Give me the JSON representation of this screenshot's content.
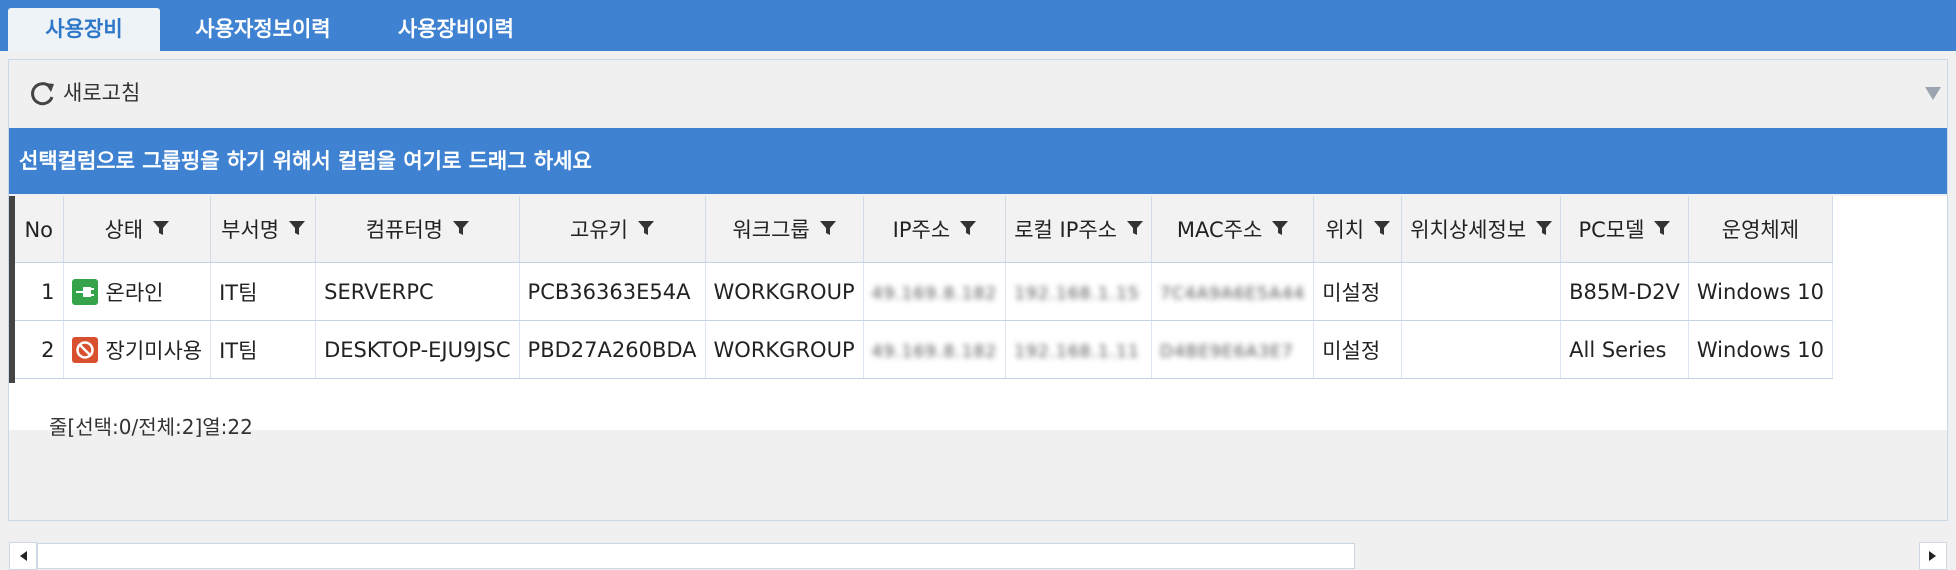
{
  "tabs": [
    {
      "label": "사용장비",
      "active": true
    },
    {
      "label": "사용자정보이력",
      "active": false
    },
    {
      "label": "사용장비이력",
      "active": false
    }
  ],
  "toolbar": {
    "refresh_label": "새로고침"
  },
  "group_bar": {
    "text": "선택컬럼으로 그룹핑을 하기 위해서 컬럼을 여기로 드래그 하세요"
  },
  "grid": {
    "columns": [
      "No",
      "상태",
      "부서명",
      "컴퓨터명",
      "고유키",
      "워크그룹",
      "IP주소",
      "로컬 IP주소",
      "MAC주소",
      "위치",
      "위치상세정보",
      "PC모델",
      "운영체제"
    ],
    "rows": [
      {
        "no": "1",
        "status": "온라인",
        "status_icon": "plug-online-icon",
        "dept": "IT팀",
        "computer": "SERVERPC",
        "key": "PCB36363E54A",
        "workgroup": "WORKGROUP",
        "ip": "49.169.8.182",
        "local_ip": "192.168.1.15",
        "mac": "7C4A9A6E5A44",
        "location": "미설정",
        "location_detail": "",
        "model": "B85M-D2V",
        "os": "Windows 10"
      },
      {
        "no": "2",
        "status": "장기미사용",
        "status_icon": "no-entry-icon",
        "dept": "IT팀",
        "computer": "DESKTOP-EJU9JSC",
        "key": "PBD27A260BDA",
        "workgroup": "WORKGROUP",
        "ip": "49.169.8.182",
        "local_ip": "192.168.1.11",
        "mac": "D4BE9E6A3E7",
        "location": "미설정",
        "location_detail": "",
        "model": "All Series",
        "os": "Windows 10"
      }
    ]
  },
  "footer": {
    "text": "줄[선택:0/전체:2]열:22"
  },
  "colors": {
    "accent": "#3f82d2",
    "online": "#35a34a",
    "inactive": "#d9502e"
  }
}
